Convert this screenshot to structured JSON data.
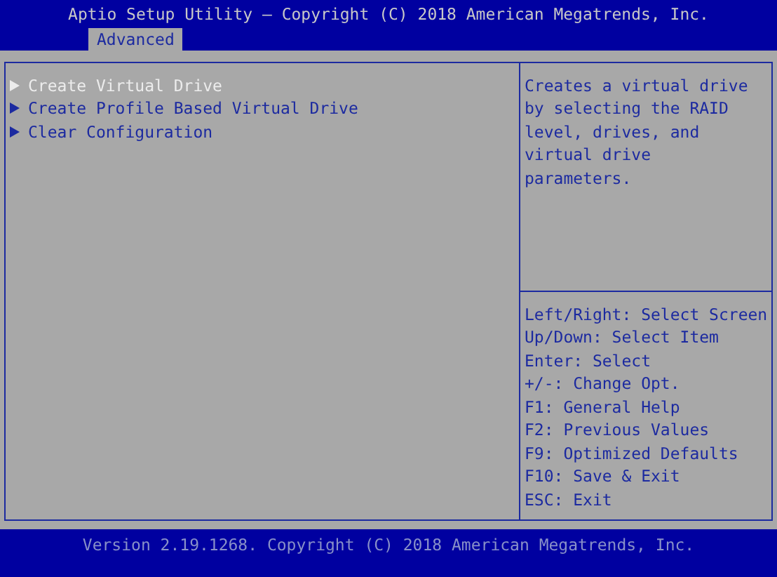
{
  "window": {
    "title": "Aptio Setup Utility – Copyright (C) 2018 American Megatrends, Inc."
  },
  "tabs": [
    {
      "label": "Advanced",
      "selected": true
    }
  ],
  "menu": {
    "items": [
      {
        "label": "Create Virtual Drive",
        "selected": true
      },
      {
        "label": "Create Profile Based Virtual Drive",
        "selected": false
      },
      {
        "label": "Clear Configuration",
        "selected": false
      }
    ]
  },
  "help": {
    "description": "Creates a virtual drive by selecting the RAID level, drives, and virtual drive parameters.",
    "keys": [
      "Left/Right: Select Screen",
      "Up/Down: Select Item",
      "Enter: Select",
      "+/-: Change Opt.",
      "F1: General Help",
      "F2: Previous Values",
      "F9: Optimized Defaults",
      "F10: Save & Exit",
      "ESC: Exit"
    ]
  },
  "status_bar": {
    "text": "Version 2.19.1268. Copyright (C) 2018 American Megatrends, Inc."
  }
}
